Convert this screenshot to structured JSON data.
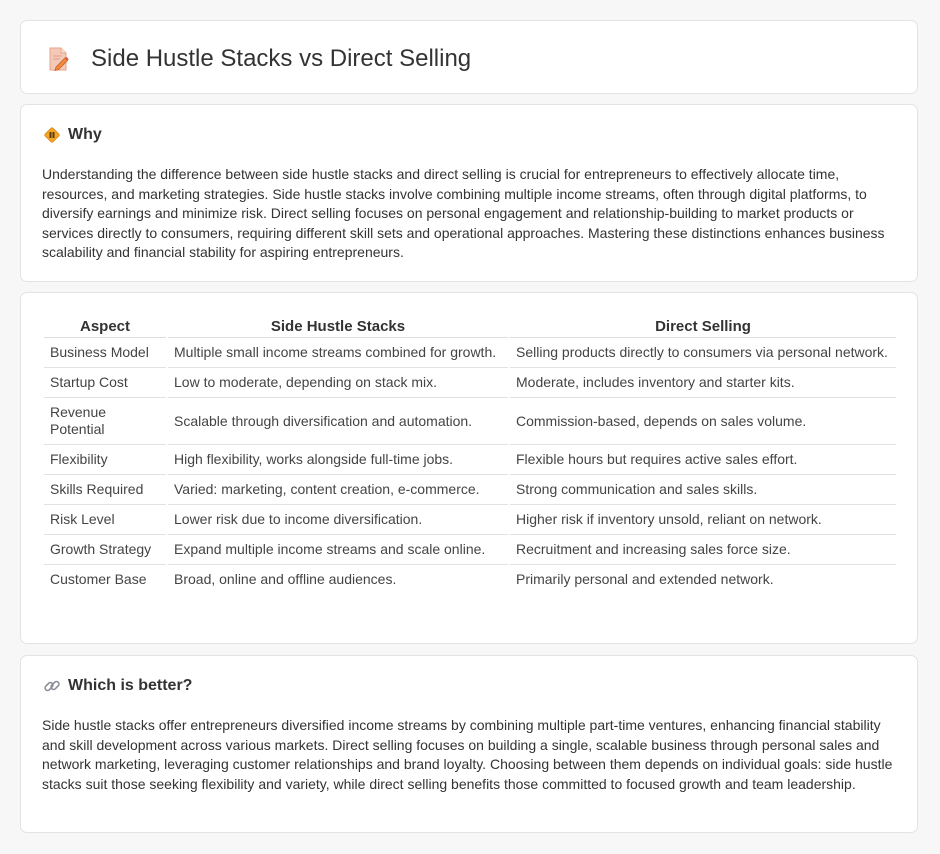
{
  "header": {
    "title": "Side Hustle Stacks vs Direct Selling",
    "icon": "document-pencil-icon"
  },
  "why": {
    "icon": "diamond-sign-icon",
    "title": "Why",
    "text": "Understanding the difference between side hustle stacks and direct selling is crucial for entrepreneurs to effectively allocate time, resources, and marketing strategies. Side hustle stacks involve combining multiple income streams, often through digital platforms, to diversify earnings and minimize risk. Direct selling focuses on personal engagement and relationship-building to market products or services directly to consumers, requiring different skill sets and operational approaches. Mastering these distinctions enhances business scalability and financial stability for aspiring entrepreneurs."
  },
  "table": {
    "headers": [
      "Aspect",
      "Side Hustle Stacks",
      "Direct Selling"
    ],
    "rows": [
      [
        "Business Model",
        "Multiple small income streams combined for growth.",
        "Selling products directly to consumers via personal network."
      ],
      [
        "Startup Cost",
        "Low to moderate, depending on stack mix.",
        "Moderate, includes inventory and starter kits."
      ],
      [
        "Revenue Potential",
        "Scalable through diversification and automation.",
        "Commission-based, depends on sales volume."
      ],
      [
        "Flexibility",
        "High flexibility, works alongside full-time jobs.",
        "Flexible hours but requires active sales effort."
      ],
      [
        "Skills Required",
        "Varied: marketing, content creation, e-commerce.",
        "Strong communication and sales skills."
      ],
      [
        "Risk Level",
        "Lower risk due to income diversification.",
        "Higher risk if inventory unsold, reliant on network."
      ],
      [
        "Growth Strategy",
        "Expand multiple income streams and scale online.",
        "Recruitment and increasing sales force size."
      ],
      [
        "Customer Base",
        "Broad, online and offline audiences.",
        "Primarily personal and extended network."
      ]
    ]
  },
  "better": {
    "icon": "link-icon",
    "title": "Which is better?",
    "text": "Side hustle stacks offer entrepreneurs diversified income streams by combining multiple part-time ventures, enhancing financial stability and skill development across various markets. Direct selling focuses on building a single, scalable business through personal sales and network marketing, leveraging customer relationships and brand loyalty. Choosing between them depends on individual goals: side hustle stacks suit those seeking flexibility and variety, while direct selling benefits those committed to focused growth and team leadership."
  }
}
